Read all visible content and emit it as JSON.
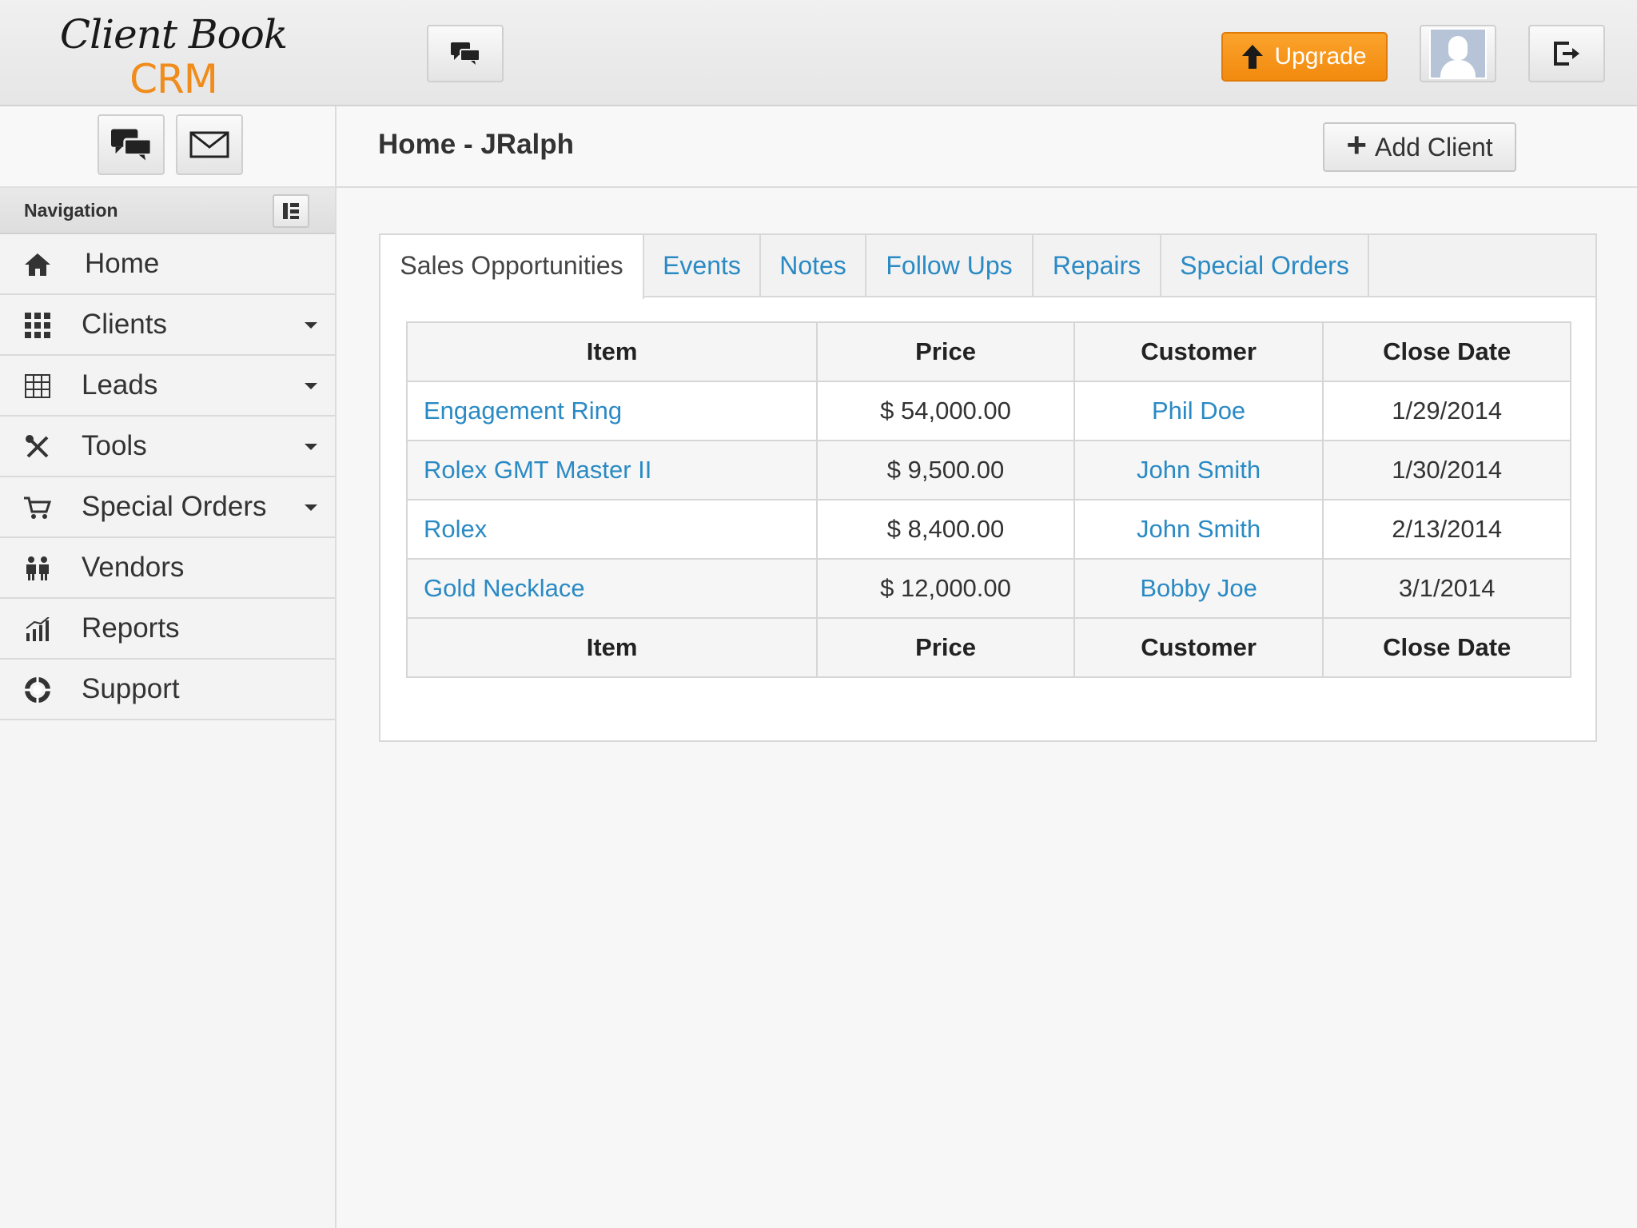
{
  "app": {
    "logo_line1": "Client Book",
    "logo_line2": "CRM",
    "upgrade_label": "Upgrade"
  },
  "sidebar": {
    "nav_header": "Navigation",
    "items": [
      {
        "label": "Home",
        "icon": "home-icon"
      },
      {
        "label": "Clients",
        "icon": "grid-icon"
      },
      {
        "label": "Leads",
        "icon": "table-icon"
      },
      {
        "label": "Tools",
        "icon": "tools-icon"
      },
      {
        "label": "Special Orders",
        "icon": "cart-icon"
      },
      {
        "label": "Vendors",
        "icon": "people-icon"
      },
      {
        "label": "Reports",
        "icon": "signal-icon"
      },
      {
        "label": "Support",
        "icon": "lifebuoy-icon"
      }
    ]
  },
  "page": {
    "title": "Home - JRalph",
    "add_client_label": "Add Client"
  },
  "tabs": [
    {
      "label": "Sales Opportunities",
      "active": true
    },
    {
      "label": "Events"
    },
    {
      "label": "Notes"
    },
    {
      "label": "Follow Ups"
    },
    {
      "label": "Repairs"
    },
    {
      "label": "Special Orders"
    }
  ],
  "table": {
    "headers": [
      "Item",
      "Price",
      "Customer",
      "Close Date"
    ],
    "rows": [
      {
        "item": "Engagement Ring",
        "price": "$ 54,000.00",
        "customer": "Phil Doe",
        "close_date": "1/29/2014"
      },
      {
        "item": "Rolex GMT Master II",
        "price": "$ 9,500.00",
        "customer": "John Smith",
        "close_date": "1/30/2014"
      },
      {
        "item": "Rolex",
        "price": "$ 8,400.00",
        "customer": "John Smith",
        "close_date": "2/13/2014"
      },
      {
        "item": "Gold Necklace",
        "price": "$ 12,000.00",
        "customer": "Bobby Joe",
        "close_date": "3/1/2014"
      }
    ]
  },
  "colors": {
    "link": "#2a8ac4",
    "accent": "#f28a0e"
  }
}
